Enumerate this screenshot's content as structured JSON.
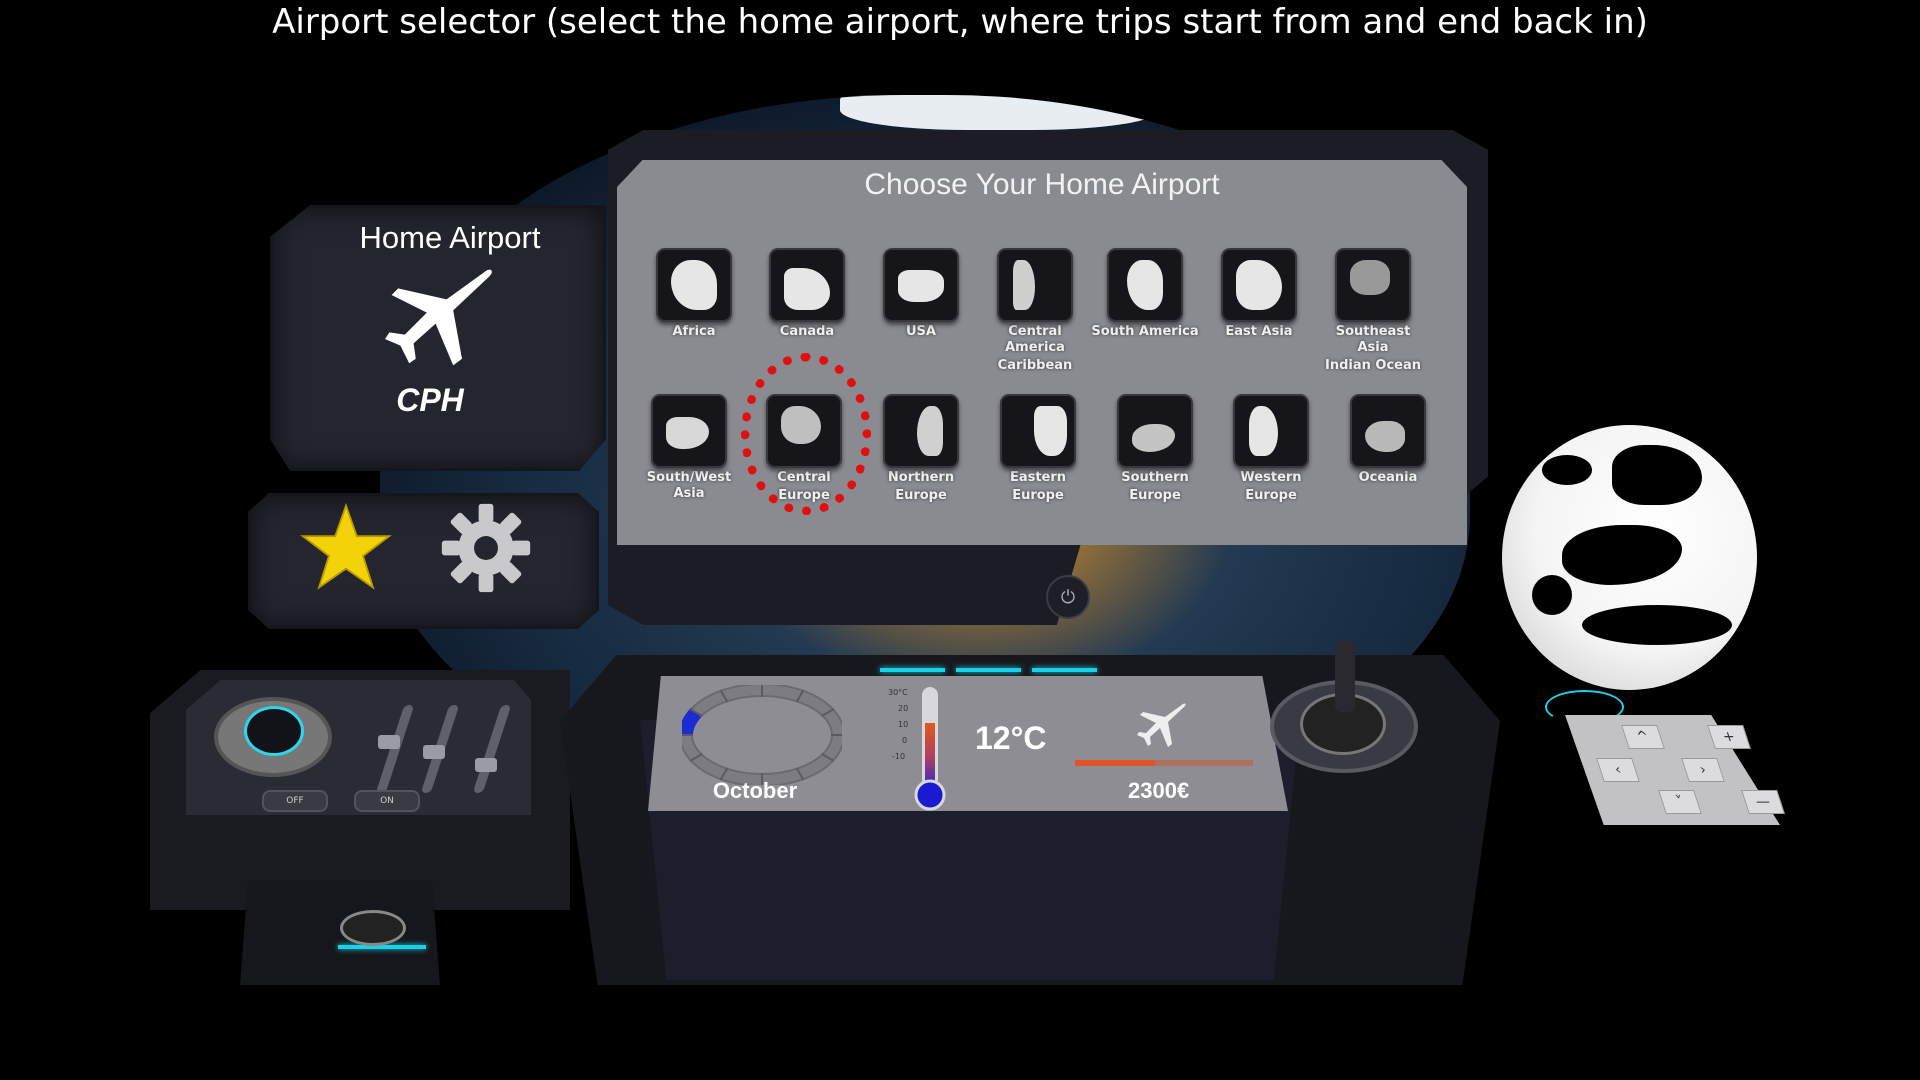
{
  "caption": "Airport selector (select the home airport, where trips start from and end back in)",
  "home_panel": {
    "title": "Home Airport",
    "airport_code": "CPH",
    "icon": "airplane-icon"
  },
  "toolbar": {
    "favorites_icon": "star-icon",
    "settings_icon": "gear-icon"
  },
  "chooser": {
    "title": "Choose Your Home Airport",
    "selected_region": "Central Europe",
    "row1": [
      {
        "label_line1": "Africa",
        "label_line2": ""
      },
      {
        "label_line1": "Canada",
        "label_line2": ""
      },
      {
        "label_line1": "USA",
        "label_line2": ""
      },
      {
        "label_line1": "Central America",
        "label_line2": "Caribbean"
      },
      {
        "label_line1": "South America",
        "label_line2": ""
      },
      {
        "label_line1": "East Asia",
        "label_line2": ""
      },
      {
        "label_line1": "Southeast Asia",
        "label_line2": "Indian Ocean"
      }
    ],
    "row2": [
      {
        "label_line1": "South/West Asia",
        "label_line2": ""
      },
      {
        "label_line1": "Central",
        "label_line2": "Europe"
      },
      {
        "label_line1": "Northern",
        "label_line2": "Europe"
      },
      {
        "label_line1": "Eastern",
        "label_line2": "Europe"
      },
      {
        "label_line1": "Southern",
        "label_line2": "Europe"
      },
      {
        "label_line1": "Western",
        "label_line2": "Europe"
      },
      {
        "label_line1": "Oceania",
        "label_line2": ""
      }
    ]
  },
  "dashboard": {
    "month": "October",
    "temperature": "12°C",
    "thermo_ticks": [
      "30°C",
      "20",
      "10",
      "0",
      "-10"
    ],
    "price": "2300€",
    "price_fraction": 0.45,
    "month_fraction": 0.083
  },
  "left_console": {
    "switch_off": "OFF",
    "switch_on": "ON"
  },
  "keypad": {
    "up": "^",
    "plus": "+",
    "left": "‹",
    "right": "›",
    "down": "˅",
    "minus": "—"
  },
  "colors": {
    "highlight": "#e01010",
    "accent_cyan": "#19d2e8",
    "price_bar": "#e0542a",
    "star": "#f3d20a"
  }
}
